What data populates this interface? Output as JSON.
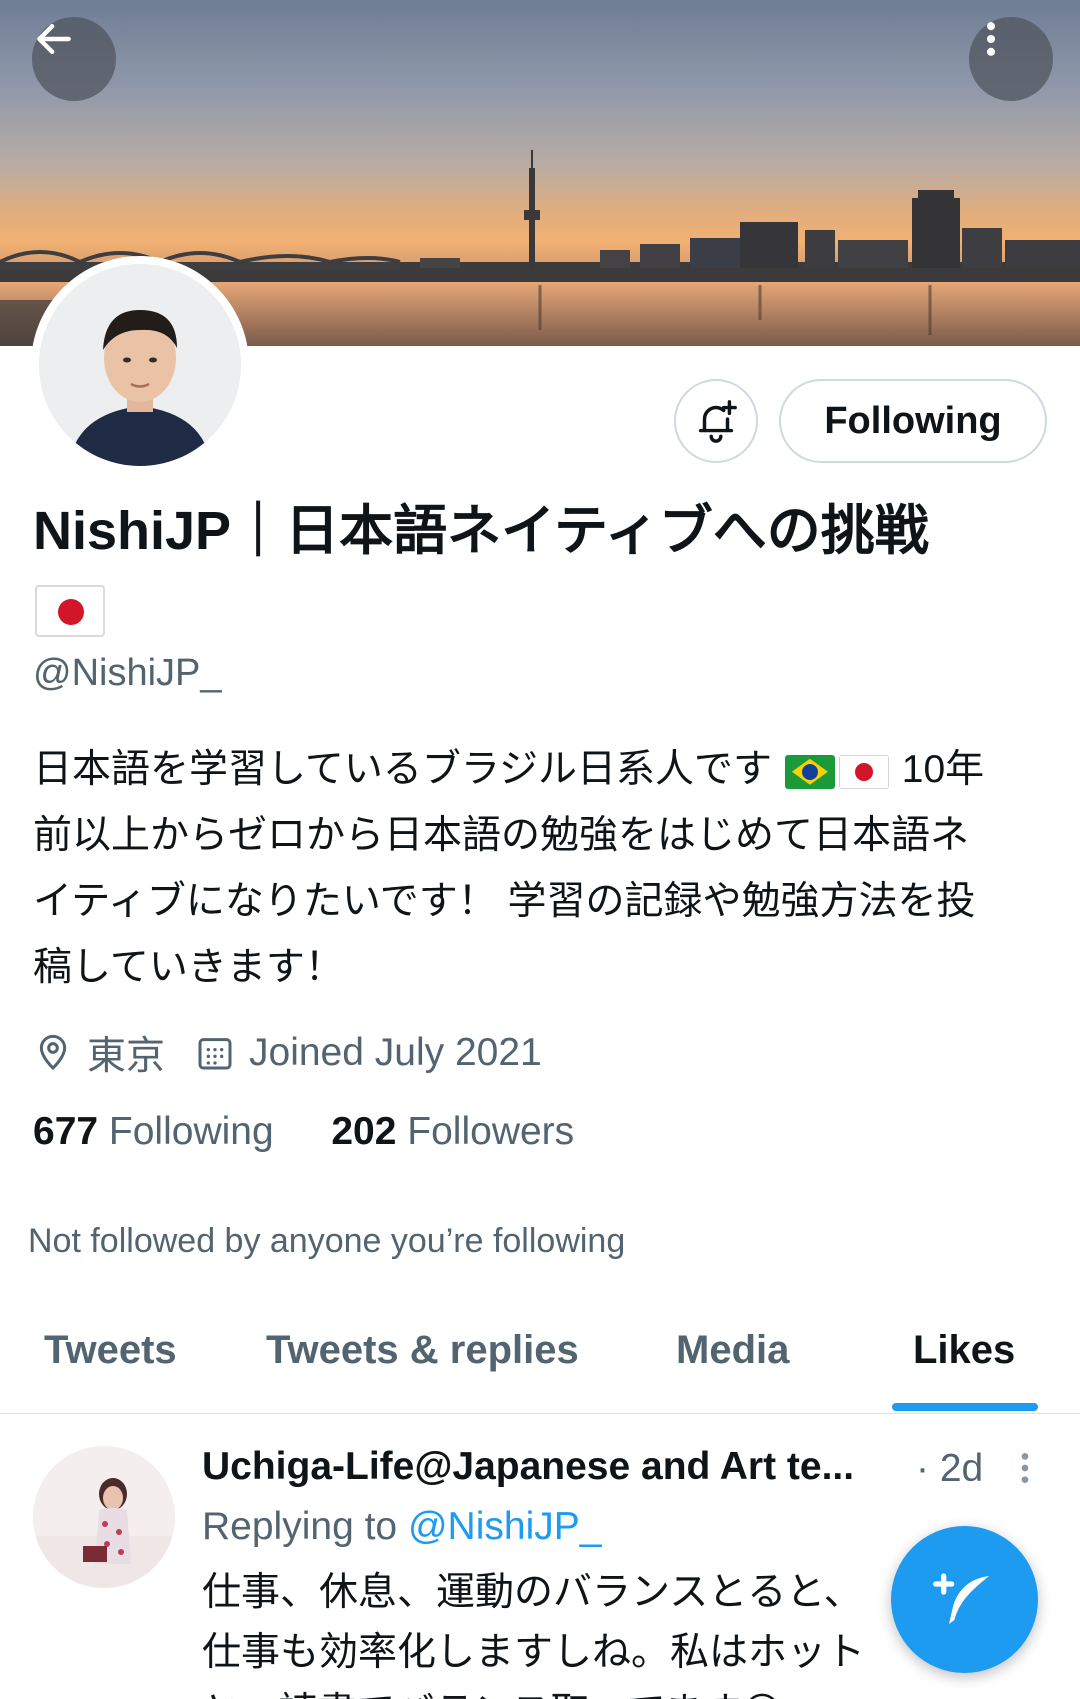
{
  "header": {
    "back_icon": "arrow-left-icon",
    "more_icon": "more-vertical-icon"
  },
  "profile": {
    "display_name": "NishiJP｜日本語ネイティブへの挑戦",
    "handle": "@NishiJP_",
    "bio_lines": [
      "日本語を学習しているブラジル日系人です",
      "10年",
      "前以上からゼロから日本語の勉強をはじめて日本語ネ",
      "イティブになりたいです！ 学習の記録や勉強方法を投",
      "稿していきます！"
    ],
    "location": "東京",
    "joined": "Joined July 2021",
    "following_count": "677",
    "following_label": "Following",
    "followers_count": "202",
    "followers_label": "Followers",
    "not_followed_text": "Not followed by anyone you’re following"
  },
  "actions": {
    "notify_icon": "bell-plus-icon",
    "following_button": "Following"
  },
  "tabs": [
    {
      "label": "Tweets",
      "active": false
    },
    {
      "label": "Tweets & replies",
      "active": false
    },
    {
      "label": "Media",
      "active": false
    },
    {
      "label": "Likes",
      "active": true
    }
  ],
  "tweet": {
    "author": "Uchiga-Life@Japanese and Art te...",
    "time": "· 2d",
    "replying_to_label": "Replying to",
    "replying_to_handle": "@NishiJP_",
    "text_lines": [
      "仕事、休息、運動のバランスとると、",
      "仕事も効率化しますしね。私はホット",
      "と、読書でバランス取ってます😊"
    ]
  },
  "fab": {
    "icon": "compose-tweet-icon"
  },
  "colors": {
    "accent": "#1d9bf0",
    "secondary_text": "#536471",
    "primary_text": "#0f1419"
  }
}
